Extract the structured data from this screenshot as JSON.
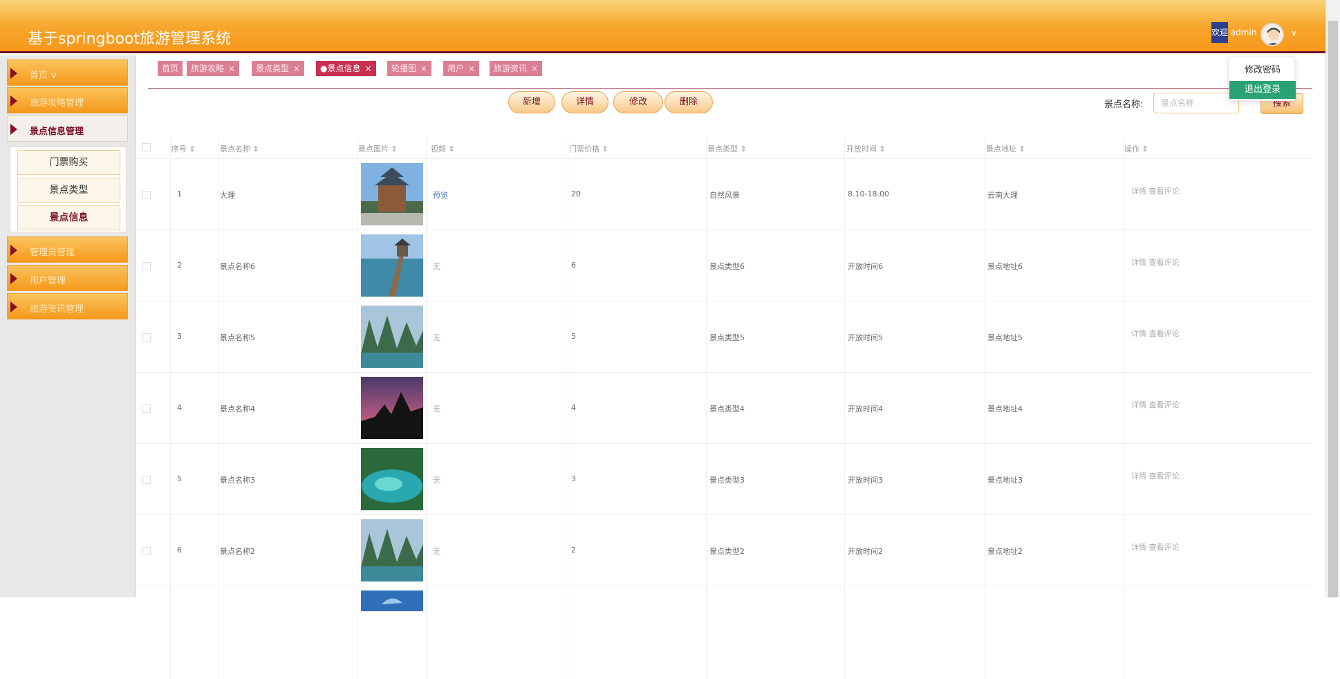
{
  "header": {
    "title": "基于springboot旅游管理系统",
    "greeting_hl": "欢迎",
    "greeting_user": " admin"
  },
  "sidebar": {
    "items": [
      {
        "label": "首页",
        "arrow": "∨"
      },
      {
        "label": "旅游攻略管理"
      },
      {
        "label": "景点信息管理"
      },
      {
        "label": "管理员管理"
      },
      {
        "label": "用户管理"
      },
      {
        "label": "旅游资讯管理"
      }
    ],
    "submenu": [
      "门票购买",
      "景点类型",
      "景点信息"
    ]
  },
  "tabs": [
    {
      "label": "首页"
    },
    {
      "label": "旅游攻略",
      "close": "×"
    },
    {
      "label": "景点类型",
      "close": "×"
    },
    {
      "label": "●景点信息",
      "close": "×"
    },
    {
      "label": "轮播图",
      "close": "×"
    },
    {
      "label": "用户",
      "close": "×"
    },
    {
      "label": "旅游资讯",
      "close": "×"
    }
  ],
  "toolbar": {
    "add": "新增",
    "detail": "详情",
    "edit": "修改",
    "delete": "删除",
    "search_label": "景点名称:",
    "search_placeholder": "景点名称",
    "search_button": "搜索"
  },
  "dropdown": {
    "change_password": "修改密码",
    "logout": "退出登录"
  },
  "table": {
    "headers": [
      "序号 ⇕",
      "景点名称 ⇕",
      "景点图片 ⇕",
      "视频 ⇕",
      "门票价格 ⇕",
      "景点类型 ⇕",
      "开放时间 ⇕",
      "景点地址 ⇕",
      "操作 ⇕"
    ],
    "rows": [
      {
        "no": "1",
        "name": "大理",
        "video": "预览",
        "price": "20",
        "type": "自然风景",
        "time": "8.10-18.00",
        "addr": "云南大理",
        "ops": "详情 查看评论"
      },
      {
        "no": "2",
        "name": "景点名称6",
        "video": "无",
        "price": "6",
        "type": "景点类型6",
        "time": "开放时间6",
        "addr": "景点地址6",
        "ops": "详情 查看评论"
      },
      {
        "no": "3",
        "name": "景点名称5",
        "video": "无",
        "price": "5",
        "type": "景点类型5",
        "time": "开放时间5",
        "addr": "景点地址5",
        "ops": "详情 查看评论"
      },
      {
        "no": "4",
        "name": "景点名称4",
        "video": "无",
        "price": "4",
        "type": "景点类型4",
        "time": "开放时间4",
        "addr": "景点地址4",
        "ops": "详情 查看评论"
      },
      {
        "no": "5",
        "name": "景点名称3",
        "video": "无",
        "price": "3",
        "type": "景点类型3",
        "time": "开放时间3",
        "addr": "景点地址3",
        "ops": "详情 查看评论"
      },
      {
        "no": "6",
        "name": "景点名称2",
        "video": "无",
        "price": "2",
        "type": "景点类型2",
        "time": "开放时间2",
        "addr": "景点地址2",
        "ops": "详情 查看评论"
      }
    ]
  },
  "colors": {
    "accent": "#f6981c",
    "brand": "#7a1024",
    "tab": "#dc7f94",
    "hover": "#2aa374"
  }
}
